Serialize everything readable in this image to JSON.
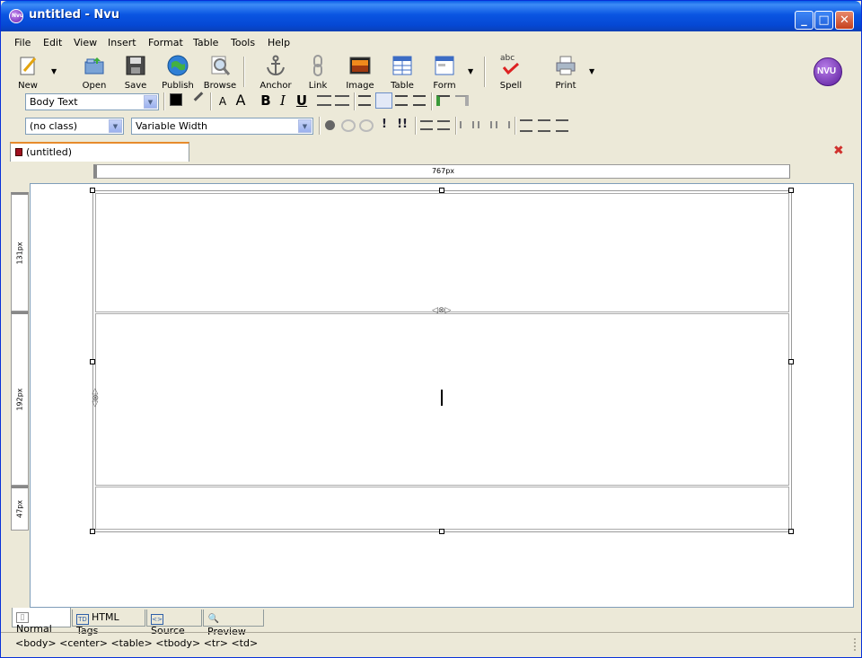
{
  "window": {
    "title": "untitled - Nvu",
    "app_icon_text": "Nvu",
    "minimize_glyph": "_",
    "maximize_glyph": "□",
    "close_glyph": "✕"
  },
  "menu": [
    "File",
    "Edit",
    "View",
    "Insert",
    "Format",
    "Table",
    "Tools",
    "Help"
  ],
  "toolbar": {
    "new": "New",
    "open": "Open",
    "save": "Save",
    "publish": "Publish",
    "browse": "Browse",
    "anchor": "Anchor",
    "link": "Link",
    "image": "Image",
    "table": "Table",
    "form": "Form",
    "spell": "Spell",
    "print": "Print",
    "spell_badge": "abc",
    "logo_text": "NVU",
    "dropdown_glyph": "▼"
  },
  "format_bar": {
    "paragraph_style": "Body Text",
    "class": "(no class)",
    "font": "Variable Width",
    "bold": "B",
    "italic": "I",
    "underline": "U",
    "smaller_font": "A",
    "larger_font": "A",
    "important": "!",
    "very_important": "!!",
    "select_arrow": "▼"
  },
  "document_tab": {
    "label": "(untitled)",
    "close_glyph": "✖"
  },
  "rulers": {
    "width_label": "767px",
    "row_heights": [
      "131px",
      "192px",
      "47px"
    ]
  },
  "table_markers": {
    "cell_mover": "◁⊗▷"
  },
  "view_tabs": [
    {
      "label": "Normal",
      "icon": "page-icon",
      "icon_glyph": "▯"
    },
    {
      "label": "HTML Tags",
      "icon": "td-icon",
      "icon_glyph": "TD"
    },
    {
      "label": "Source",
      "icon": "source-icon",
      "icon_glyph": "<>"
    },
    {
      "label": "Preview",
      "icon": "magnifier-icon",
      "icon_glyph": "🔍"
    }
  ],
  "status": {
    "tag_path": "<body> <center> <table> <tbody> <tr> <td>"
  },
  "colors": {
    "titlebar": "#0a55e2",
    "window_bg": "#ece9d8",
    "active_tab_accent": "#e68b2c",
    "close_button": "#c5401d"
  }
}
